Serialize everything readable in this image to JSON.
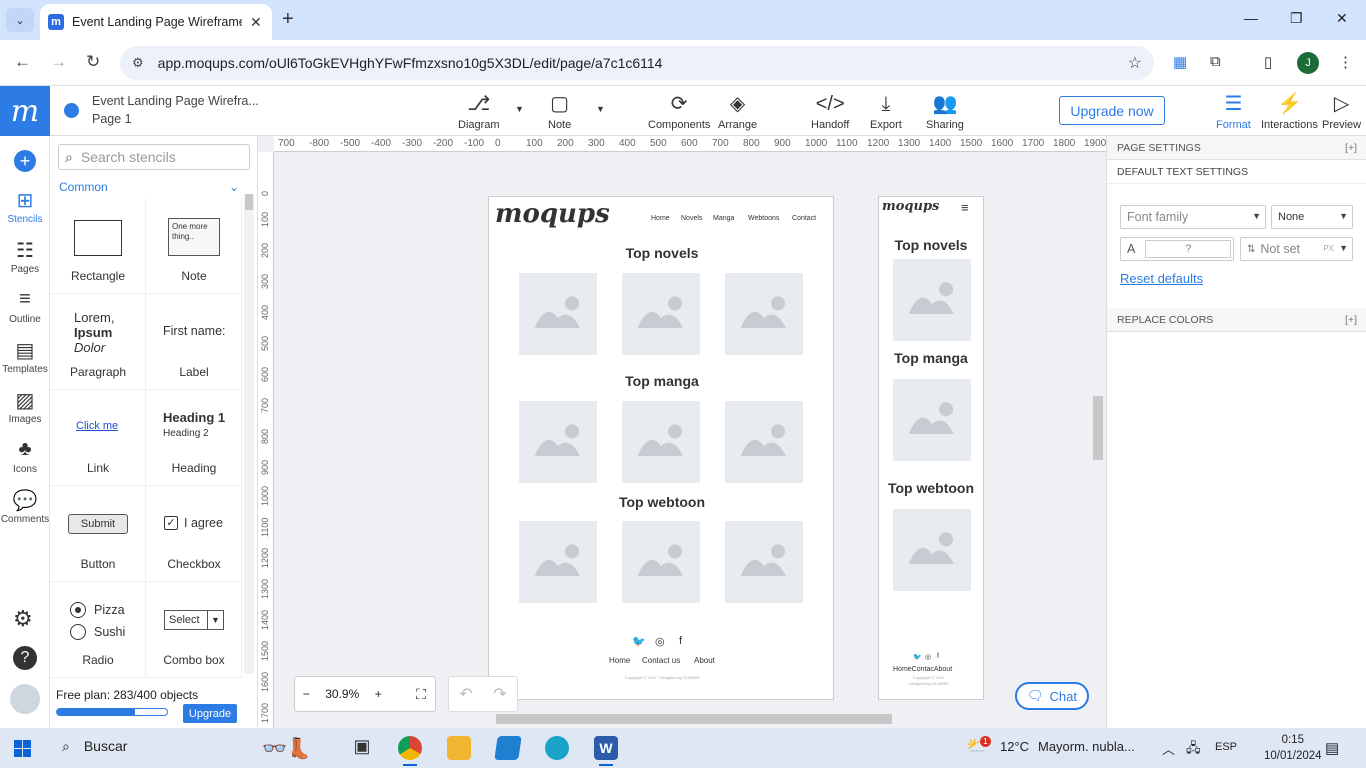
{
  "browser": {
    "tab_title": "Event Landing Page Wireframe",
    "url": "app.moqups.com/oUl6ToGkEVHghYFwFfmzxsno10g5X3DL/edit/page/a7c1c6114",
    "profile_initial": "J"
  },
  "app": {
    "project_title": "Event Landing Page Wirefra...",
    "page_name": "Page 1",
    "toolbar": [
      {
        "label": "Diagram",
        "icon": "diagram-icon"
      },
      {
        "label": "Note",
        "icon": "note-icon"
      },
      {
        "label": "Components",
        "icon": "components-icon"
      },
      {
        "label": "Arrange",
        "icon": "arrange-icon"
      },
      {
        "label": "Handoff",
        "icon": "code-icon"
      },
      {
        "label": "Export",
        "icon": "download-icon"
      },
      {
        "label": "Sharing",
        "icon": "add-user-icon"
      }
    ],
    "upgrade_label": "Upgrade now",
    "right_tools": [
      {
        "label": "Format",
        "icon": "format-icon",
        "active": true
      },
      {
        "label": "Interactions",
        "icon": "lightning-icon",
        "active": false
      },
      {
        "label": "Preview",
        "icon": "play-icon",
        "active": false
      }
    ]
  },
  "leftnav": [
    {
      "label": "Stencils",
      "icon": "stencils-icon",
      "active": true
    },
    {
      "label": "Pages",
      "icon": "pages-icon"
    },
    {
      "label": "Outline",
      "icon": "outline-icon"
    },
    {
      "label": "Templates",
      "icon": "templates-icon"
    },
    {
      "label": "Images",
      "icon": "images-icon"
    },
    {
      "label": "Icons",
      "icon": "club-icon"
    },
    {
      "label": "Comments",
      "icon": "comments-icon"
    }
  ],
  "stencils": {
    "search_placeholder": "Search stencils",
    "category": "Common",
    "items": {
      "rectangle": "Rectangle",
      "note": "Note",
      "note_preview": "One more thing..",
      "paragraph": "Paragraph",
      "paragraph_l1": "Lorem,",
      "paragraph_l2": "Ipsum",
      "paragraph_l3": "Dolor",
      "label": "Label",
      "label_preview": "First name:",
      "link": "Link",
      "link_preview": "Click me",
      "heading": "Heading",
      "heading_1": "Heading 1",
      "heading_2": "Heading 2",
      "button": "Button",
      "button_preview": "Submit",
      "checkbox": "Checkbox",
      "checkbox_preview": "I agree",
      "radio": "Radio",
      "radio_1": "Pizza",
      "radio_2": "Sushi",
      "combo": "Combo box",
      "combo_preview": "Select"
    },
    "plan_text": "Free plan: 283/400 objects",
    "plan_progress": 0.7075,
    "plan_upgrade": "Upgrade"
  },
  "canvas": {
    "ruler_h": [
      "700",
      "-800",
      "-500",
      "-400",
      "-300",
      "-200",
      "-100",
      "0",
      "100",
      "200",
      "300",
      "400",
      "500",
      "600",
      "700",
      "800",
      "900",
      "1000",
      "1100",
      "1200",
      "1300",
      "1400",
      "1500",
      "1600",
      "1700",
      "1800",
      "1900"
    ],
    "ruler_v": [
      "0",
      "100",
      "200",
      "300",
      "400",
      "500",
      "600",
      "700",
      "800",
      "900",
      "1000",
      "1100",
      "1200",
      "1300",
      "1400",
      "1500",
      "1600",
      "1700"
    ],
    "desktop": {
      "logo": "moqups",
      "nav": [
        "Home",
        "Novels",
        "Manga",
        "Webtoons",
        "Contact"
      ],
      "sections": [
        "Top novels",
        "Top manga",
        "Top webtoon"
      ],
      "footer_links": [
        "Home",
        "Contact us",
        "About"
      ],
      "copyright": "Copyright © 2024 · Designed by ELWEBS"
    },
    "mobile": {
      "logo": "moqups",
      "sections": [
        "Top novels",
        "Top manga",
        "Top webtoon"
      ],
      "footer_links": "HomeContacAbout",
      "copyright_1": "Copyright © 2024",
      "copyright_2": "Designed by ELWEBS"
    },
    "zoom": "30.9%",
    "chat_label": "Chat"
  },
  "rightpanel": {
    "page_settings": "PAGE SETTINGS",
    "default_text": "DEFAULT TEXT SETTINGS",
    "font_family": "Font family",
    "font_weight": "None",
    "font_size": "?",
    "line_height": "Not set",
    "line_unit": "PX",
    "reset": "Reset defaults",
    "replace_colors": "REPLACE COLORS",
    "expand": "[+]"
  },
  "taskbar": {
    "search": "Buscar",
    "weather_temp": "12°C",
    "weather_text": "Mayorm. nubla...",
    "lang": "ESP",
    "time": "0:15",
    "date": "10/01/2024",
    "notif_count": "1"
  },
  "colors": {
    "accent": "#2d7be5",
    "canvas_bg": "#eef0f3",
    "placeholder": "#e8ebef"
  }
}
